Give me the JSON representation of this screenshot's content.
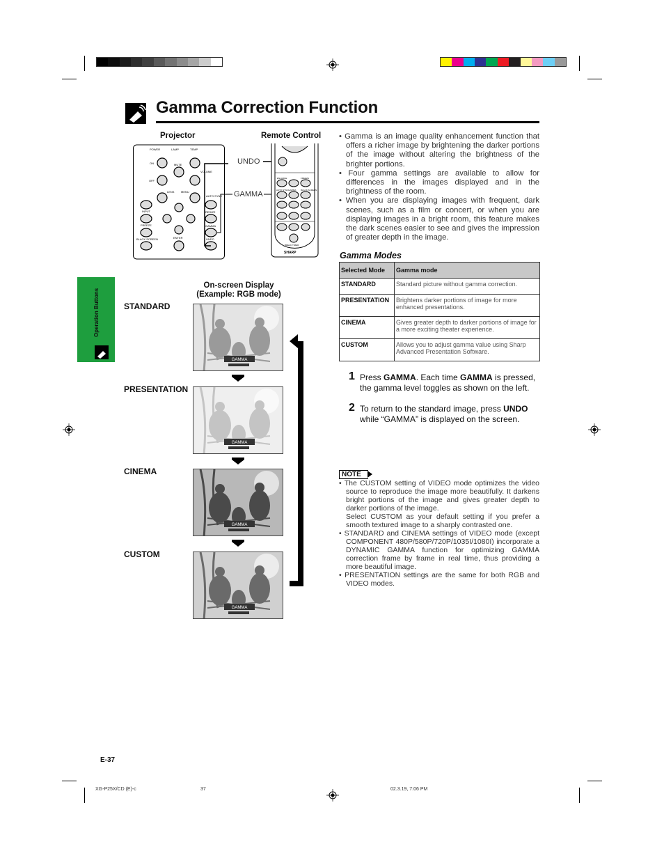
{
  "colors": {
    "accent_green": "#1e9e3e",
    "left_bars": [
      "#000000",
      "#0d0d0d",
      "#1c1c1c",
      "#2e2e2e",
      "#404040",
      "#5a5a5a",
      "#737373",
      "#8c8c8c",
      "#a6a6a6",
      "#cccccc",
      "#ffffff"
    ],
    "right_bars": [
      "#fff200",
      "#ec008c",
      "#00aeef",
      "#2e3192",
      "#00a651",
      "#ed1c24",
      "#231f20",
      "#fff799",
      "#f49ac1",
      "#6dcff6",
      "#999999"
    ]
  },
  "page": {
    "title": "Gamma Correction Function",
    "side_tab": "Operation Buttons",
    "page_number": "E-37"
  },
  "diagram": {
    "projector_label": "Projector",
    "remote_label": "Remote Control",
    "undo_callout": "UNDO",
    "gamma_callout": "GAMMA",
    "projector_buttons": {
      "power": "POWER",
      "lamp": "LAMP",
      "temp": "TEMP",
      "on": "ON",
      "off": "OFF",
      "mute": "MUTE",
      "volume": "VOLUME",
      "lens": "LENS",
      "menu": "MENU",
      "auto_sync": "AUTO SYNC",
      "resize": "RESIZE",
      "input": "INPUT",
      "in123": "1 2 3",
      "in45": "4 5",
      "freeze": "FREEZE",
      "gamma": "GAMMA",
      "black_screen": "BLACK SCREEN",
      "enter": "ENTER",
      "undo": "UNDO"
    },
    "remote_buttons": {
      "brand": "SHARP",
      "enlarge": "ENLARGE",
      "freeze": "FREEZE",
      "auto_sync": "AUTO SYNC",
      "gamma": "GAMMA",
      "black_screen": "BLACK SCREEN",
      "input1": "INPUT 1",
      "input2": "INPUT 2",
      "input3": "INPUT 3",
      "input4": "INPUT 4",
      "input5": "INPUT 5",
      "resize": "RESIZE",
      "volume": "VOL",
      "mute": "MUTE",
      "break_timer": "BREAK TIMER"
    }
  },
  "intro": [
    "Gamma is an image quality enhancement function that offers a richer image by brightening the darker portions of the image without altering the brightness of the brighter portions.",
    "Four gamma settings are available to allow for differences in the images displayed and in the brightness of the room.",
    "When you are displaying images with frequent, dark scenes, such as a film or concert, or when you are displaying images in a bright room, this feature makes the dark scenes easier to see and gives the impression of greater depth in the image."
  ],
  "gamma_modes": {
    "heading": "Gamma Modes",
    "headers": [
      "Selected Mode",
      "Gamma mode"
    ],
    "rows": [
      [
        "STANDARD",
        "Standard picture without gamma correction."
      ],
      [
        "PRESENTATION",
        "Brightens darker portions of image for more enhanced presentations."
      ],
      [
        "CINEMA",
        "Gives greater depth to darker portions of image for a more exciting theater experience."
      ],
      [
        "CUSTOM",
        "Allows you to adjust gamma value using Sharp Advanced Presentation Software."
      ]
    ]
  },
  "osd": {
    "heading_line1": "On-screen Display",
    "heading_line2": "(Example: RGB mode)",
    "modes": [
      "STANDARD",
      "PRESENTATION",
      "CINEMA",
      "CUSTOM"
    ],
    "overlay_label": "GAMMA"
  },
  "steps": [
    {
      "num": "1",
      "pre": "Press ",
      "key": "GAMMA",
      "mid": ". Each time ",
      "key2": "GAMMA",
      "post": " is pressed, the gamma level toggles as shown on the left."
    },
    {
      "num": "2",
      "pre": "To return to the standard image, press ",
      "key": "UNDO",
      "post": " while “GAMMA” is displayed on the screen."
    }
  ],
  "note": {
    "label": "NOTE",
    "items": [
      "The CUSTOM setting of VIDEO mode optimizes the video source to reproduce the image more beautifully. It darkens bright portions of the image and gives greater depth to darker portions of the image.",
      "Select CUSTOM as your default setting if you prefer a smooth textured image to a sharply contrasted one.",
      "STANDARD and CINEMA settings of VIDEO mode (except COMPONENT 480P/580P/720P/1035I/1080I) incorporate a DYNAMIC GAMMA function for optimizing GAMMA correction frame by frame in real time, thus providing a more beautiful image.",
      "PRESENTATION settings are the same for both RGB and VIDEO modes."
    ]
  },
  "footer": {
    "file": "XG-P25X/CD (E)-c",
    "page": "37",
    "date": "02.3.19, 7:06 PM"
  }
}
